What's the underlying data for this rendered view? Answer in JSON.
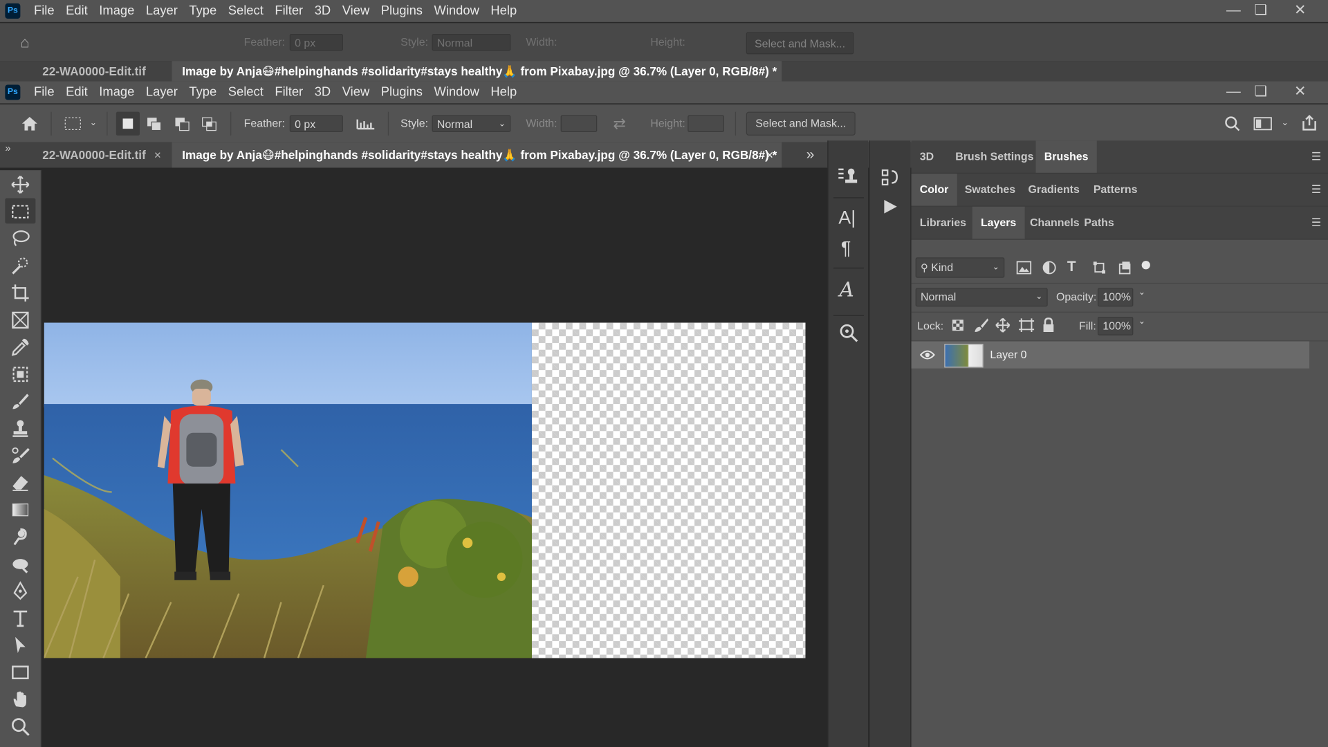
{
  "app": {
    "logo": "Ps"
  },
  "menu": [
    "File",
    "Edit",
    "Image",
    "Layer",
    "Type",
    "Select",
    "Filter",
    "3D",
    "View",
    "Plugins",
    "Window",
    "Help"
  ],
  "options": {
    "feather_label": "Feather:",
    "feather_value": "0 px",
    "style_label": "Style:",
    "style_value": "Normal",
    "width_label": "Width:",
    "height_label": "Height:",
    "select_mask_label": "Select and Mask..."
  },
  "tabs": {
    "inactive_label": "22-WA0000-Edit.tif",
    "active_label": "Image by Anja😷#helpinghands #solidarity#stays healthy🙏 from Pixabay.jpg @ 36.7% (Layer 0, RGB/8#) *",
    "close_glyph": "×",
    "overflow_glyph": "»"
  },
  "panels": {
    "row1": [
      "3D",
      "Brush Settings",
      "Brushes"
    ],
    "row1_active": "Brushes",
    "row2": [
      "Color",
      "Swatches",
      "Gradients",
      "Patterns"
    ],
    "row2_active": "Color",
    "row3": [
      "Libraries",
      "Layers",
      "Channels",
      "Paths"
    ],
    "row3_active": "Layers"
  },
  "layers_panel": {
    "filter_label": "Kind",
    "blend_mode": "Normal",
    "opacity_label": "Opacity:",
    "opacity_value": "100%",
    "lock_label": "Lock:",
    "fill_label": "Fill:",
    "fill_value": "100%",
    "layers": [
      {
        "name": "Layer 0",
        "visible": true
      }
    ]
  },
  "colors": {
    "accent": "#31a8ff",
    "panel_bg": "#535353",
    "canvas_bg": "#282828"
  }
}
